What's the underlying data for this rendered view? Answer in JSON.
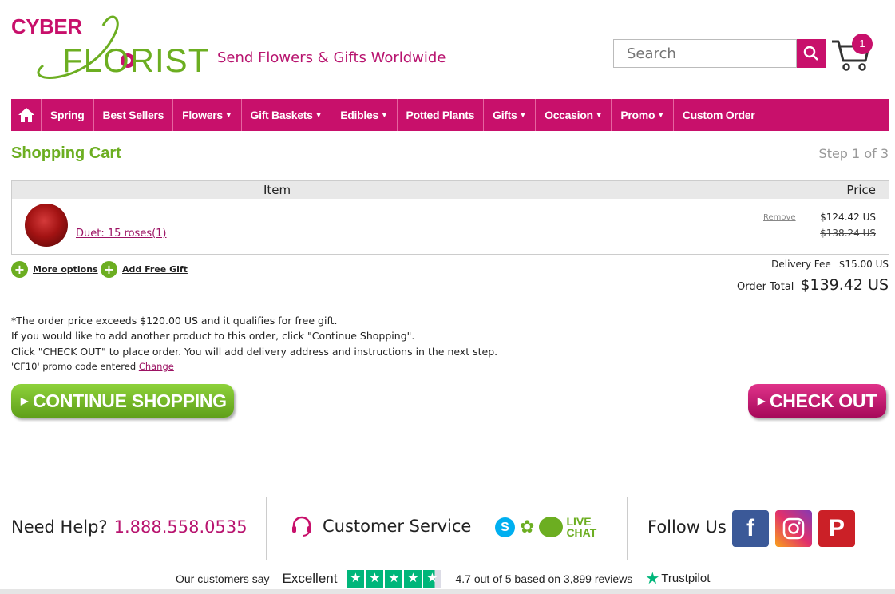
{
  "header": {
    "logo_text_top": "CYBER",
    "logo_text_bottom": "FLORIST",
    "tagline": "Send Flowers & Gifts Worldwide",
    "search_placeholder": "Search",
    "cart_count": "1"
  },
  "nav": {
    "items": [
      {
        "label": "Spring",
        "dropdown": false
      },
      {
        "label": "Best Sellers",
        "dropdown": false
      },
      {
        "label": "Flowers",
        "dropdown": true
      },
      {
        "label": "Gift Baskets",
        "dropdown": true
      },
      {
        "label": "Edibles",
        "dropdown": true
      },
      {
        "label": "Potted Plants",
        "dropdown": false
      },
      {
        "label": "Gifts",
        "dropdown": true
      },
      {
        "label": "Occasion",
        "dropdown": true
      },
      {
        "label": "Promo",
        "dropdown": true
      },
      {
        "label": "Custom Order",
        "dropdown": false
      }
    ]
  },
  "cart": {
    "title": "Shopping Cart",
    "step": "Step 1 of 3",
    "col_item": "Item",
    "col_price": "Price",
    "product_name": "Duet: 15 roses(1)",
    "remove_label": "Remove",
    "price_now": "$124.42 US",
    "price_old": "$138.24 US",
    "more_options": "More options",
    "add_free_gift": "Add Free Gift",
    "delivery_fee_label": "Delivery Fee",
    "delivery_fee": "$15.00 US",
    "order_total_label": "Order Total",
    "order_total": "$139.42 US",
    "notes": [
      "*The order price exceeds $120.00 US and it qualifies for free gift.",
      "If you would like to add another product to this order, click \"Continue Shopping\".",
      "Click \"CHECK OUT\" to place order. You will add delivery address and instructions in the next step."
    ],
    "promo_note": "'CF10' promo code entered",
    "promo_change": "Change",
    "continue_label": "CONTINUE SHOPPING",
    "checkout_label": "CHECK OUT"
  },
  "footer": {
    "help_label": "Need Help?",
    "phone": "1.888.558.0535",
    "customer_service": "Customer Service",
    "live_chat_line1": "LIVE",
    "live_chat_line2": "CHAT",
    "follow_us": "Follow Us",
    "social_icons": [
      "facebook-icon",
      "instagram-icon",
      "pinterest-icon"
    ]
  },
  "trustpilot": {
    "customers_say": "Our customers say",
    "excellent": "Excellent",
    "rating_text": "4.7 out of 5 based on",
    "reviews": "3,899 reviews",
    "brand": "Trustpilot",
    "rating_value": 4.7
  },
  "colors": {
    "brand_magenta": "#c8106b",
    "brand_green": "#6cae21",
    "trustpilot_green": "#00b67a"
  }
}
